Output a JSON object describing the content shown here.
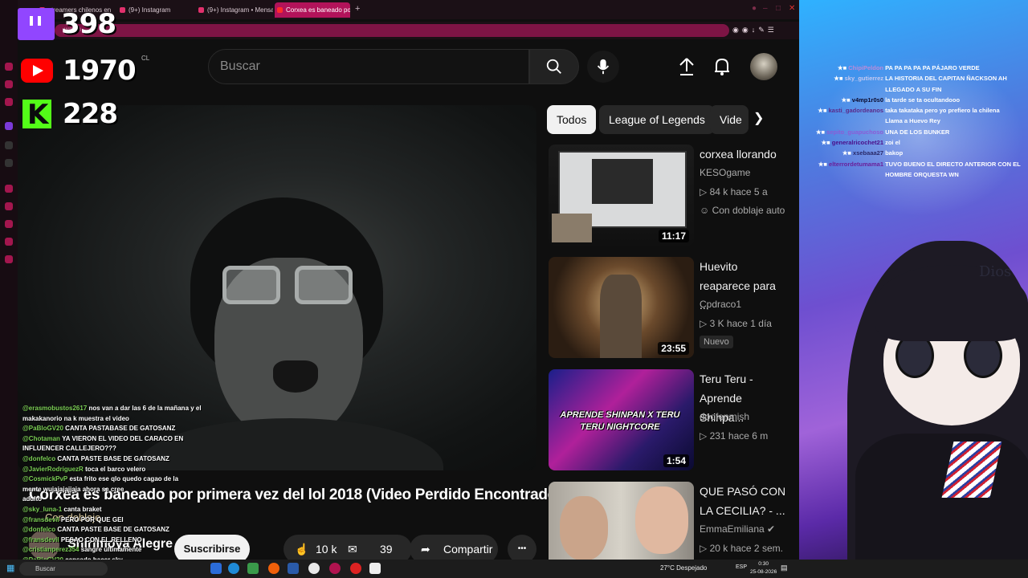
{
  "browser": {
    "tabs": [
      {
        "label": "streamers chilenos en viv"
      },
      {
        "label": "(9+) Instagram"
      },
      {
        "label": "(9+) Instagram • Mensajes"
      },
      {
        "label": "Corxea es baneado por pr"
      }
    ],
    "new_tab": "+",
    "address_text": "watch"
  },
  "overlay_counters": {
    "twitch": "398",
    "youtube": "1970",
    "kick": "228",
    "region": "CL"
  },
  "youtube": {
    "search_placeholder": "Buscar",
    "chips": [
      "Todos",
      "League of Legends",
      "Vide"
    ],
    "video_title": "Corxea es baneado por primera vez del lol 2018 (Video Perdido Encontrado)",
    "dubbed_label": "Con doblaje",
    "channel_name": "Shirimoya Alegre",
    "subscribe_label": "Suscribirse",
    "likes": "10 k",
    "comments": "39",
    "share_label": "Compartir",
    "more": "•••"
  },
  "recommendations": [
    {
      "title": "corxea llorando",
      "channel": "KESOgame",
      "meta": "84 k   hace 5 a",
      "extra": "Con doblaje auto",
      "duration": "11:17"
    },
    {
      "title": "Huevito reaparece para ...",
      "channel": "Cpdraco1",
      "meta": "3 K   hace 1 día",
      "extra": "Nuevo",
      "duration": "23:55"
    },
    {
      "title": "Teru Teru - Aprende Shinpa...",
      "channel": "doofenmish",
      "meta": "231   hace 6 m",
      "extra": "",
      "duration": "1:54",
      "thumb_text": "APRENDE SHINPAN X TERU TERU NIGHTCORE"
    },
    {
      "title": "QUE PASÓ CON LA CECILIA? - ...",
      "channel": "EmmaEmiliana",
      "meta": "20 k   hace 2 sem.",
      "extra": "",
      "duration": ""
    }
  ],
  "left_chat": [
    {
      "user": "@erasmobustos2617",
      "msg": "nos van a dar las 6 de la mañana y el"
    },
    {
      "user": "",
      "msg": "makakanorio na k muestra el video"
    },
    {
      "user": "@PaBloGV20",
      "msg": "CANTA PASTABASE DE GATOSANZ"
    },
    {
      "user": "@Chotaman",
      "msg": "YA VIERON EL VIDEO DEL CARACO EN"
    },
    {
      "user": "",
      "msg": "INFLUENCER CALLEJERO???"
    },
    {
      "user": "@donfelco",
      "msg": "CANTA PASTE BASE DE GATOSANZ"
    },
    {
      "user": "@JavierRodriguezR",
      "msg": "toca el barco velero"
    },
    {
      "user": "@CosmickPvP",
      "msg": "esta frito ese qlo quedo cagao de la"
    },
    {
      "user": "",
      "msg": "mente wujajajajjaja ahora se cree"
    },
    {
      "user": "",
      "msg": "adulto"
    },
    {
      "user": "@sky_luna-1",
      "msg": "canta braket"
    },
    {
      "user": "@fransdevil",
      "msg": "PERO POR QUE GEI"
    },
    {
      "user": "@donfelco",
      "msg": "CANTA PASTE BASE DE GATOSANZ"
    },
    {
      "user": "@fransdevil",
      "msg": "PESAO CON EL RELLENO"
    },
    {
      "user": "@cristianperez354",
      "msg": "sangre ultimamente"
    },
    {
      "user": "@PaBloGV20",
      "msg": "cansado hacer sky"
    },
    {
      "user": "@donfelco",
      "msg": "CANTA PASTE BASE DE GATOSANZ"
    }
  ],
  "right_chat": [
    {
      "user": "ChipiPeldon",
      "msg": "PA PA PA PA PA PÁJARO VERDE",
      "color": "#b98bd9"
    },
    {
      "user": "sky_gutierrez",
      "msg": "LA HISTORIA DEL CAPITAN ÑACKSON AH",
      "color": "#c5c9f0"
    },
    {
      "user": "",
      "msg": "LLEGADO A SU FIN",
      "color": "#ffffff"
    },
    {
      "user": "v4mp1r0s0",
      "msg": "la tarde se ta ocultandooo",
      "color": "#0b0b2e"
    },
    {
      "user": "kasti_gadordeanos",
      "msg": "taka takataka pero yo prefiero la chilena",
      "color": "#5a2a8a"
    },
    {
      "user": "",
      "msg": "Llama a Huevo Rey",
      "color": "#ffffff"
    },
    {
      "user": "sepito_guapuchoso",
      "msg": "UNA DE LOS BUNKER",
      "color": "#8b5cd6"
    },
    {
      "user": "generalricochet21",
      "msg": "zoi el",
      "color": "#4a0f8a"
    },
    {
      "user": "xsebaaa27",
      "msg": "bakop",
      "color": "#2a2a6a"
    },
    {
      "user": "elterrordetumama1",
      "msg": "TUVO BUENO EL DIRECTO ANTERIOR CON EL",
      "color": "#6a1f9a"
    },
    {
      "user": "",
      "msg": "HOMBRE ORQUESTA WN",
      "color": "#ffffff"
    }
  ],
  "vtuber_text": "Dios",
  "taskbar": {
    "search": "Buscar",
    "weather": "27°C  Despejado",
    "lang": "ESP",
    "time": "0:30",
    "date": "25-08-2026"
  }
}
